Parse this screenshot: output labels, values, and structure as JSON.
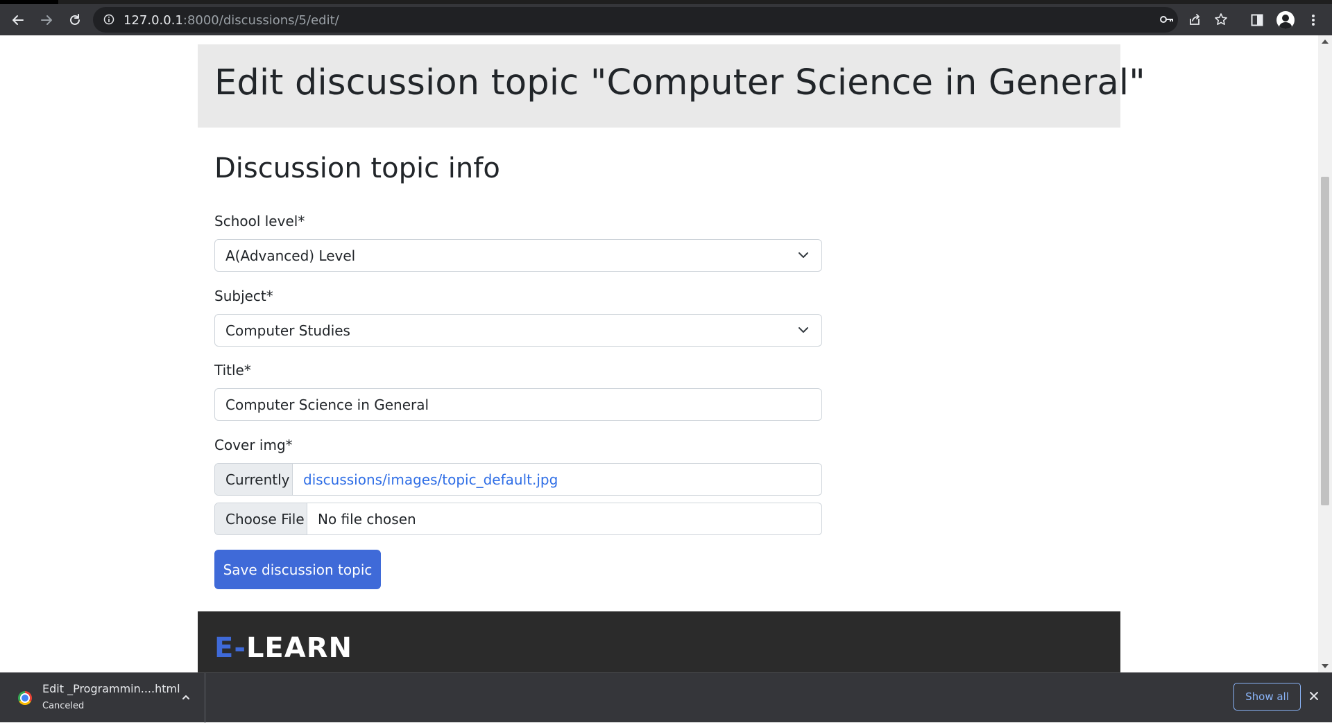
{
  "browser": {
    "url_host": "127.0.0.1",
    "url_path": ":8000/discussions/5/edit/",
    "icons": [
      "back-icon",
      "forward-icon",
      "reload-icon",
      "info-icon",
      "key-icon",
      "share-icon",
      "star-icon",
      "side-panel-icon",
      "profile-icon",
      "menu-icon"
    ]
  },
  "page": {
    "heading": "Edit discussion topic \"Computer Science in General\"",
    "section_title": "Discussion topic info",
    "form": {
      "school_level": {
        "label": "School level*",
        "value": "A(Advanced) Level"
      },
      "subject": {
        "label": "Subject*",
        "value": "Computer Studies"
      },
      "title": {
        "label": "Title*",
        "value": "Computer Science in General"
      },
      "cover_img": {
        "label": "Cover img*",
        "currently_label": "Currently",
        "current_file": "discussions/images/topic_default.jpg",
        "choose_label": "Choose File",
        "no_file": "No file chosen"
      },
      "submit_label": "Save discussion topic"
    },
    "footer": {
      "brand_accent": "E-",
      "brand_rest": "LEARN"
    }
  },
  "downloads": {
    "item_name": "Edit _Programmin....html",
    "item_status": "Canceled",
    "show_all": "Show all"
  },
  "colors": {
    "primary": "#3f6ad8",
    "link": "#2f6ee6",
    "jumbotron": "#e9e9e9",
    "footer": "#2b2b2b",
    "chrome": "#35363a"
  }
}
